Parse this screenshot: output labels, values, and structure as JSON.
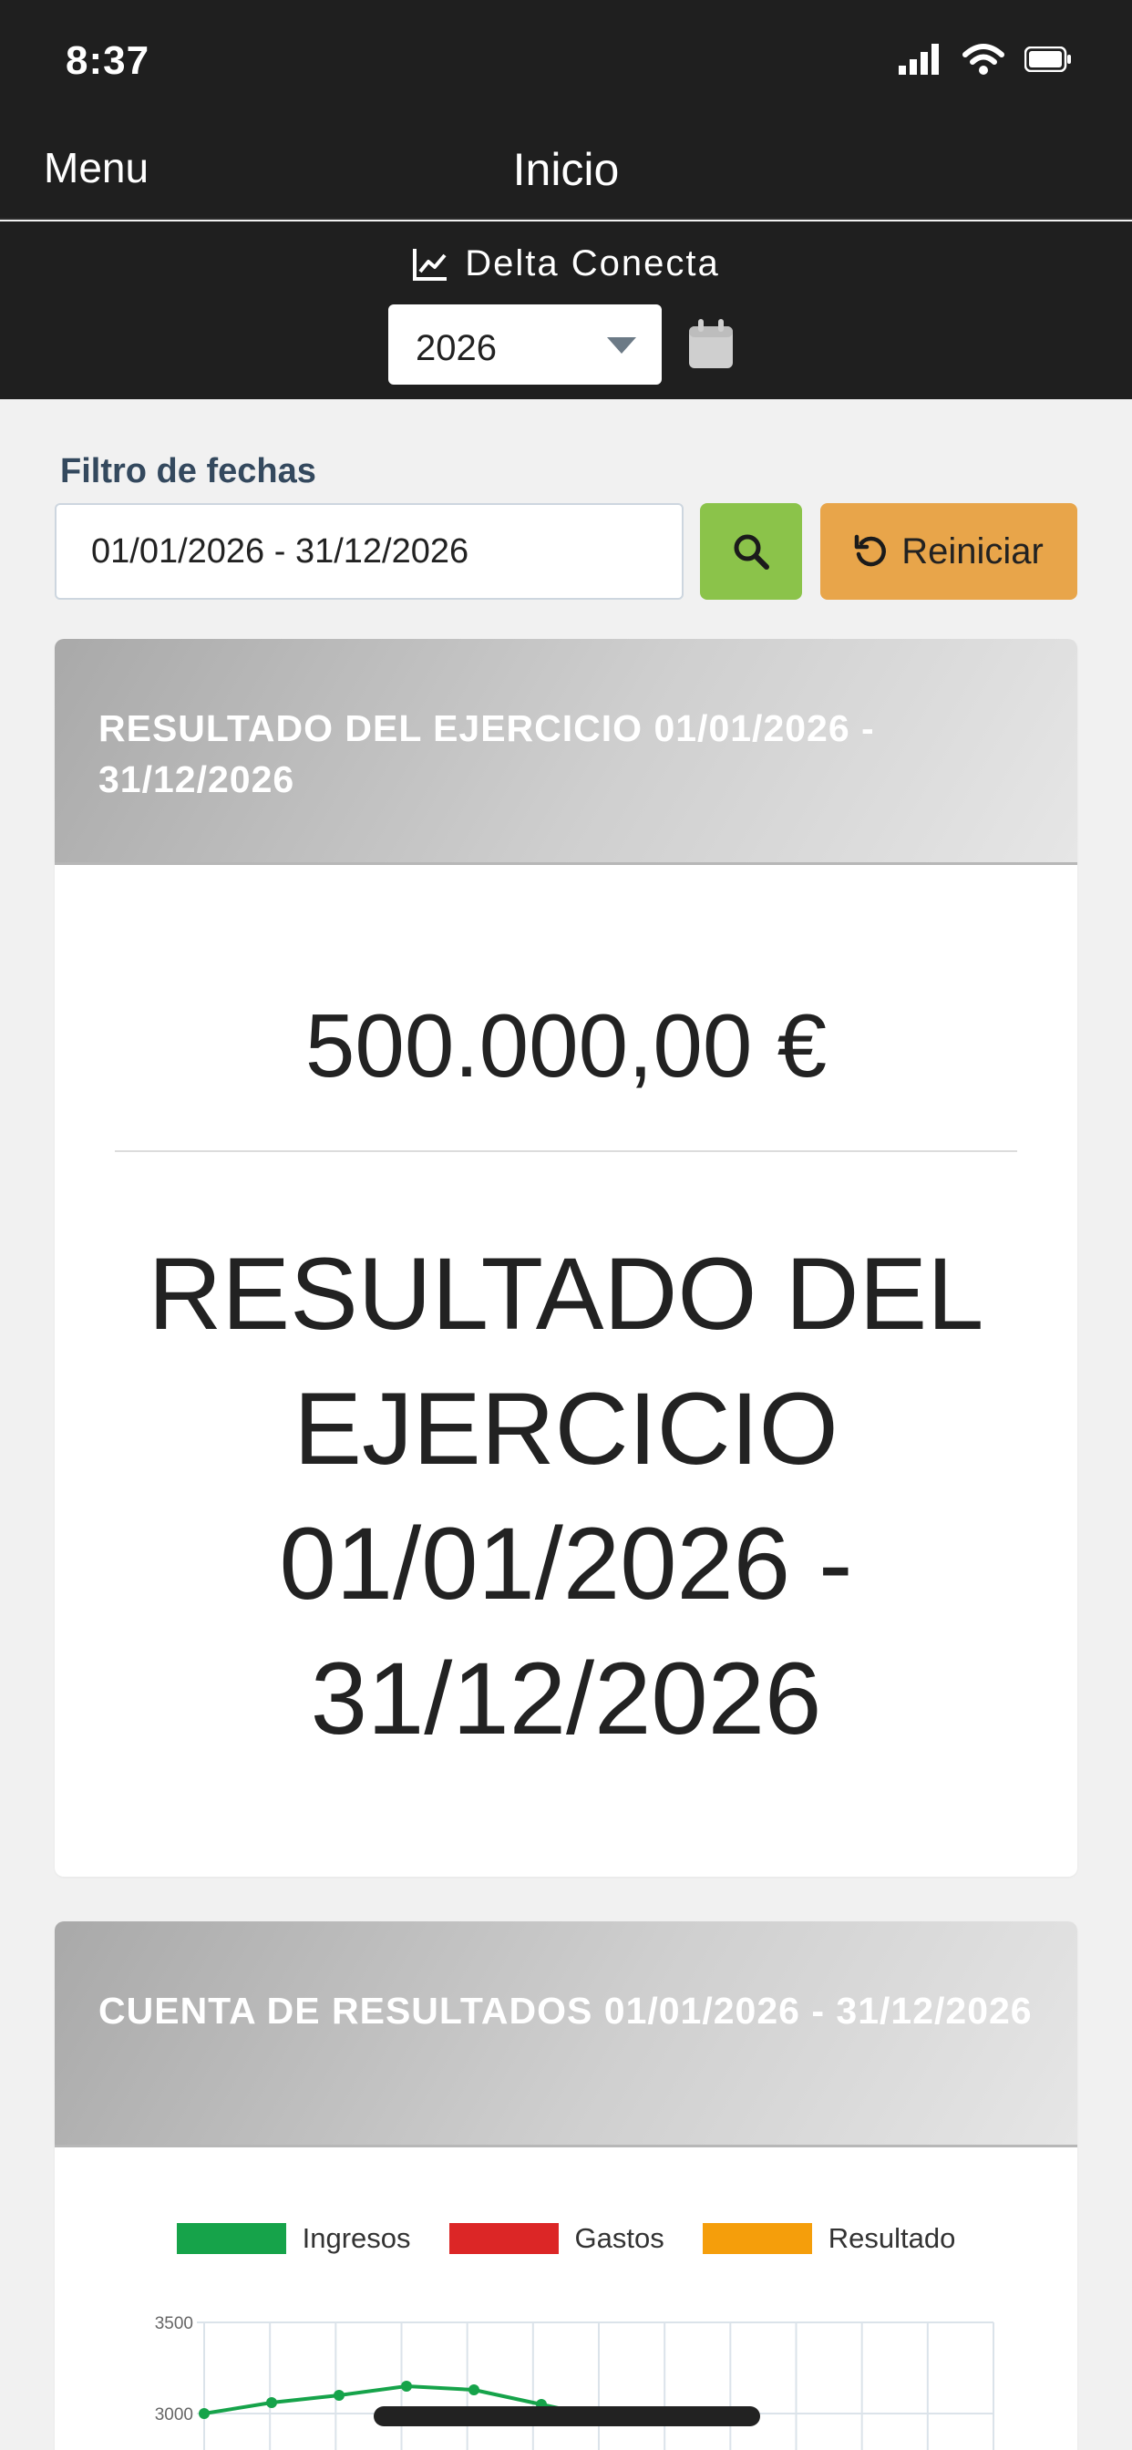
{
  "status": {
    "time": "8:37",
    "icons": [
      "signal-icon",
      "wifi-icon",
      "battery-icon"
    ]
  },
  "nav": {
    "menu_label": "Menu",
    "title": "Inicio"
  },
  "brand": {
    "icon": "line-chart-icon",
    "name": "Delta Conecta"
  },
  "year_select": {
    "value": "2026",
    "icon": "calendar-icon"
  },
  "filter": {
    "label": "Filtro de fechas",
    "range_value": "01/01/2026 - 31/12/2026",
    "search_icon": "search-icon",
    "reset_icon": "undo-icon",
    "reset_label": "Reiniciar"
  },
  "card_result": {
    "header": "RESULTADO DEL EJERCICIO 01/01/2026 - 31/12/2026",
    "value": "500.000,00 €",
    "label": "RESULTADO DEL EJERCICIO 01/01/2026 - 31/12/2026"
  },
  "card_pl": {
    "header": "CUENTA DE RESULTADOS 01/01/2026 - 31/12/2026"
  },
  "colors": {
    "ingresos": "#16a34a",
    "gastos": "#dc2626",
    "resultado": "#f59e0b"
  },
  "chart_data": {
    "type": "line",
    "series": [
      {
        "name": "Ingresos",
        "values": [
          3000,
          3060,
          3100,
          3150,
          3130,
          3050,
          2970
        ]
      },
      {
        "name": "Gastos",
        "values": []
      },
      {
        "name": "Resultado",
        "values": []
      }
    ],
    "y_ticks": [
      "3500",
      "3000"
    ],
    "ylim_visible": [
      2900,
      3500
    ],
    "grid": true,
    "legend": "top-center"
  }
}
